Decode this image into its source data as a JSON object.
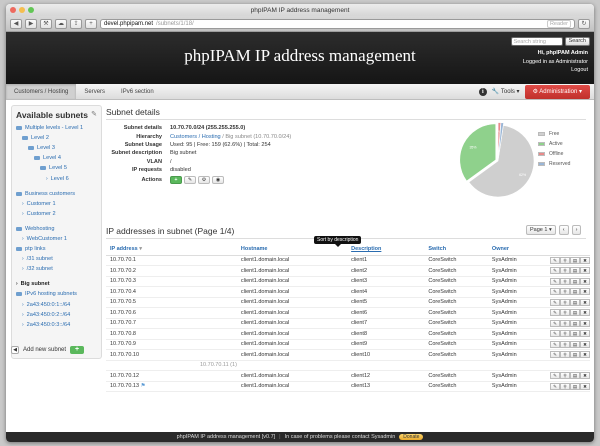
{
  "browser": {
    "title": "phpIPAM IP address management",
    "url_host": "devel.phpipam.net",
    "url_path": "/subnets/1/18/",
    "reader_label": "Reader"
  },
  "header": {
    "app_title": "phpIPAM IP address management",
    "search_placeholder": "Search string",
    "search_button": "Search",
    "greeting": "Hi, phpIPAM Admin",
    "logged_in_as": "Logged in as Administrator",
    "logout": "Logout"
  },
  "nav": {
    "tabs": [
      {
        "label": "Customers / Hosting",
        "active": true
      },
      {
        "label": "Servers",
        "active": false
      },
      {
        "label": "IPv6 section",
        "active": false
      }
    ],
    "tools_label": "Tools",
    "admin_label": "Administration",
    "admin_color": "#d0413c"
  },
  "sidebar": {
    "title": "Available subnets",
    "items": [
      {
        "label": "Multiple levels - Level 1",
        "indent": 0,
        "kind": "folder"
      },
      {
        "label": "Level 2",
        "indent": 1,
        "kind": "folder"
      },
      {
        "label": "Level 3",
        "indent": 2,
        "kind": "folder"
      },
      {
        "label": "Level 4",
        "indent": 3,
        "kind": "folder"
      },
      {
        "label": "Level 5",
        "indent": 4,
        "kind": "folder"
      },
      {
        "label": "Level 6",
        "indent": 5,
        "kind": "arrow"
      },
      {
        "label": "",
        "indent": 0,
        "kind": "gap"
      },
      {
        "label": "Business customers",
        "indent": 0,
        "kind": "folder"
      },
      {
        "label": "Customer 1",
        "indent": 1,
        "kind": "arrow"
      },
      {
        "label": "Customer 2",
        "indent": 1,
        "kind": "arrow"
      },
      {
        "label": "",
        "indent": 0,
        "kind": "gap"
      },
      {
        "label": "Webhosting",
        "indent": 0,
        "kind": "folder"
      },
      {
        "label": "WebCustomer 1",
        "indent": 1,
        "kind": "arrow"
      },
      {
        "label": "ptp links",
        "indent": 0,
        "kind": "folder"
      },
      {
        "label": "/31 subnet",
        "indent": 1,
        "kind": "arrow"
      },
      {
        "label": "/32 subnet",
        "indent": 1,
        "kind": "arrow"
      },
      {
        "label": "",
        "indent": 0,
        "kind": "gap"
      },
      {
        "label": "Big subnet",
        "indent": 0,
        "kind": "bold"
      },
      {
        "label": "IPv6 hosting subnets",
        "indent": 0,
        "kind": "folder"
      },
      {
        "label": "2a43:450:0:1::/64",
        "indent": 1,
        "kind": "arrow"
      },
      {
        "label": "2a43:450:0:2::/64",
        "indent": 1,
        "kind": "arrow"
      },
      {
        "label": "2a43:450:0:3::/64",
        "indent": 1,
        "kind": "arrow"
      }
    ],
    "add_label": "Add new subnet"
  },
  "subnet": {
    "section_title": "Subnet details",
    "rows": [
      {
        "label": "Subnet details",
        "value": "10.70.70.0/24 (255.255.255.0)"
      },
      {
        "label": "Hierarchy",
        "value": "Customers / Hosting / Big subnet (10.70.70.0/24)"
      },
      {
        "label": "Subnet Usage",
        "value": "Used: 95 | Free: 159 (62.6%) | Total: 254"
      },
      {
        "label": "Subnet description",
        "value": "Big subnet"
      },
      {
        "label": "VLAN",
        "value": "/"
      },
      {
        "label": "IP requests",
        "value": "disabled"
      },
      {
        "label": "Actions",
        "value": ""
      }
    ],
    "hierarchy_link": "Customers / Hosting",
    "hierarchy_rest": " / Big subnet (10.70.70.0/24)"
  },
  "chart_data": {
    "type": "pie",
    "series": [
      {
        "name": "Free",
        "value": 62.6,
        "color": "#cfcfcf"
      },
      {
        "name": "Active",
        "value": 35.0,
        "color": "#8fd18c"
      },
      {
        "name": "Offline",
        "value": 1.2,
        "color": "#e88a8a"
      },
      {
        "name": "Reserved",
        "value": 1.2,
        "color": "#9ab6d6"
      }
    ],
    "slice_labels": [
      "62%",
      "35%",
      "1%"
    ]
  },
  "ip_table": {
    "title": "IP addresses in subnet (Page 1/4)",
    "page_label": "Page 1",
    "tooltip": "Sort by description",
    "columns": [
      "IP address",
      "Hostname",
      "Description",
      "Switch",
      "Owner"
    ],
    "rows": [
      {
        "ip": "10.70.70.1",
        "host": "client1.domain.local",
        "desc": "client1",
        "switch": "CoreSwitch",
        "owner": "SysAdmin"
      },
      {
        "ip": "10.70.70.2",
        "host": "client1.domain.local",
        "desc": "client2",
        "switch": "CoreSwitch",
        "owner": "SysAdmin"
      },
      {
        "ip": "10.70.70.3",
        "host": "client1.domain.local",
        "desc": "client3",
        "switch": "CoreSwitch",
        "owner": "SysAdmin"
      },
      {
        "ip": "10.70.70.4",
        "host": "client1.domain.local",
        "desc": "client4",
        "switch": "CoreSwitch",
        "owner": "SysAdmin"
      },
      {
        "ip": "10.70.70.5",
        "host": "client1.domain.local",
        "desc": "client5",
        "switch": "CoreSwitch",
        "owner": "SysAdmin"
      },
      {
        "ip": "10.70.70.6",
        "host": "client1.domain.local",
        "desc": "client6",
        "switch": "CoreSwitch",
        "owner": "SysAdmin"
      },
      {
        "ip": "10.70.70.7",
        "host": "client1.domain.local",
        "desc": "client7",
        "switch": "CoreSwitch",
        "owner": "SysAdmin"
      },
      {
        "ip": "10.70.70.8",
        "host": "client1.domain.local",
        "desc": "client8",
        "switch": "CoreSwitch",
        "owner": "SysAdmin"
      },
      {
        "ip": "10.70.70.9",
        "host": "client1.domain.local",
        "desc": "client9",
        "switch": "CoreSwitch",
        "owner": "SysAdmin"
      },
      {
        "ip": "10.70.70.10",
        "host": "client1.domain.local",
        "desc": "client10",
        "switch": "CoreSwitch",
        "owner": "SysAdmin"
      },
      {
        "ip": "10.70.70.11 (1)",
        "host": "",
        "desc": "",
        "switch": "",
        "owner": "",
        "free": true
      },
      {
        "ip": "10.70.70.12",
        "host": "client1.domain.local",
        "desc": "client12",
        "switch": "CoreSwitch",
        "owner": "SysAdmin"
      },
      {
        "ip": "10.70.70.13",
        "host": "client1.domain.local",
        "desc": "client13",
        "switch": "CoreSwitch",
        "owner": "SysAdmin"
      }
    ]
  },
  "footer": {
    "text": "phpIPAM IP address management [v0.7]",
    "contact": "In case of problems please contact Sysadmin",
    "donate": "Donate"
  }
}
